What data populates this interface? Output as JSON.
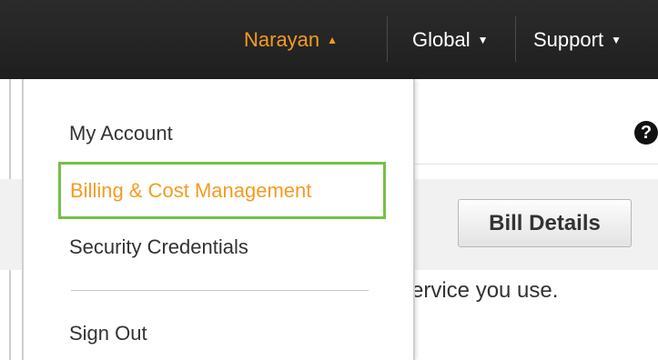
{
  "topnav": {
    "user_label": "Narayan",
    "user_caret": "▲",
    "region_label": "Global",
    "region_caret": "▼",
    "support_label": "Support",
    "support_caret": "▼"
  },
  "account_menu": {
    "items": [
      {
        "label": "My Account"
      },
      {
        "label": "Billing & Cost Management",
        "highlighted": true
      },
      {
        "label": "Security Credentials"
      },
      {
        "label": "Sign Out"
      }
    ],
    "highlight_color": "#76bf47",
    "active_text_color": "#f59b22"
  },
  "content": {
    "help_glyph": "?",
    "bill_details_label": "Bill Details",
    "description_fragment": "service you use."
  }
}
